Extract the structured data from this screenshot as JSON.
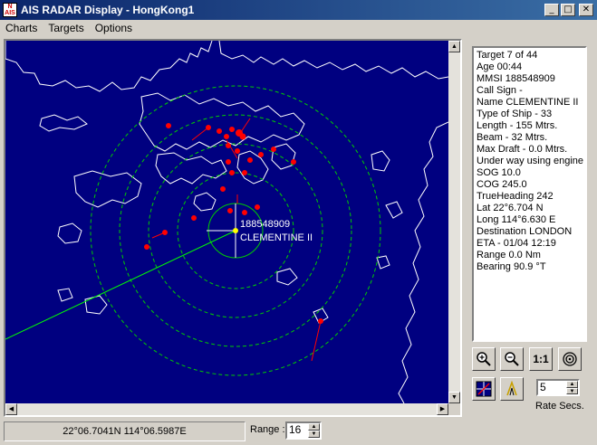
{
  "window": {
    "title": "AIS RADAR Display - HongKong1",
    "icon_text": "N AIS"
  },
  "menu": [
    "Charts",
    "Targets",
    "Options"
  ],
  "map": {
    "own_ship_mmsi": "188548909",
    "own_ship_name": "CLEMENTINE II",
    "colors": {
      "sea": "#000080",
      "coast": "#ffffff",
      "ring": "#00cc00",
      "target": "#ff0000",
      "own_ship": "#ffff00"
    }
  },
  "target_info": [
    "Target 7 of 44",
    "Age 00:44",
    "MMSI 188548909",
    "Call Sign -",
    "Name CLEMENTINE II",
    "Type of Ship - 33",
    "Length - 155 Mtrs.",
    "Beam - 32 Mtrs.",
    "Max Draft - 0.0 Mtrs.",
    "Under way using engine",
    "SOG 10.0",
    "COG 245.0",
    "TrueHeading 242",
    "Lat 22°6.704 N",
    "Long 114°6.630 E",
    "Destination LONDON",
    "ETA - 01/04 12:19",
    "Range 0.0 Nm",
    "Bearing 90.9 °T"
  ],
  "toolbar": {
    "zoom_in_icon": "zoom-in-icon",
    "zoom_out_icon": "zoom-out-icon",
    "one_to_one": "1:1",
    "rate_value": "5",
    "rate_label": "Rate Secs."
  },
  "status": {
    "coords": "22°06.7041N 114°06.5987E",
    "range_label": "Range :",
    "range_value": "16"
  }
}
